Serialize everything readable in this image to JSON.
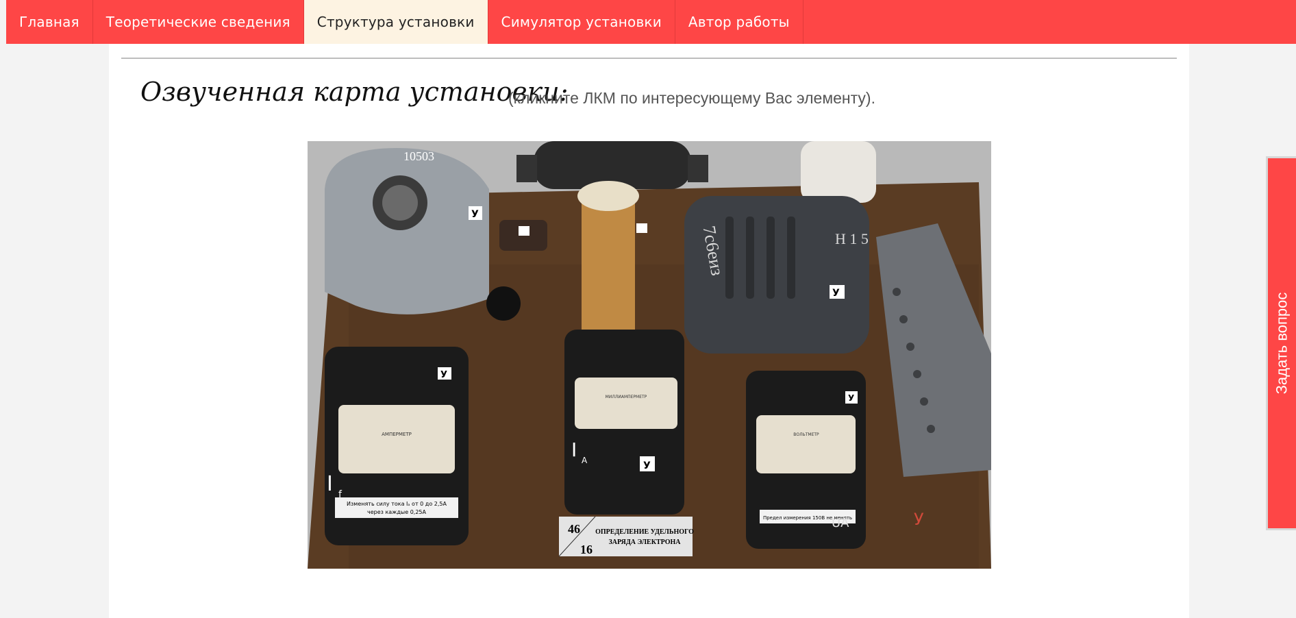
{
  "nav": {
    "items": [
      {
        "label": "Главная",
        "active": false
      },
      {
        "label": "Теоретические сведения",
        "active": false
      },
      {
        "label": "Структура установки",
        "active": true
      },
      {
        "label": "Симулятор установки",
        "active": false
      },
      {
        "label": "Автор работы",
        "active": false
      }
    ]
  },
  "main": {
    "heading": "Озвученная карта установки:",
    "hint": "(кликните ЛКМ по интересующему Вас элементу)."
  },
  "photo": {
    "label_main_top": "46",
    "label_main_bottom": "16",
    "label_title_line1": "ОПРЕДЕЛЕНИЕ УДЕЛЬНОГО",
    "label_title_line2": "ЗАРЯДА ЭЛЕКТРОНА",
    "note_left_line1": "Изменять силу тока Iₐ от 0 до 2,5А",
    "note_left_line2": "через каждые 0,25А",
    "note_right": "Предел измерения 150В не менять",
    "device_label": "У",
    "meter_left_letter": "I",
    "meter_left_sub": "f",
    "meter_mid_letter": "I",
    "meter_mid_sub": "A",
    "meter_right_letters": "UA",
    "handwritten_box": "7с6еиз",
    "handwritten_box2": "Н 1 5",
    "plate_top": "10503",
    "meter_left_title": "АМПЕРМЕТР",
    "meter_mid_title": "МИЛЛИАМПЕРМЕТР",
    "meter_right_title": "ВОЛЬТМЕТР",
    "bench_mark": "У"
  },
  "ask_button": {
    "label": "Задать вопрос"
  },
  "colors": {
    "accent": "#fe4646",
    "active_tab": "#fdf3e2",
    "wood": "#5a3c23"
  }
}
